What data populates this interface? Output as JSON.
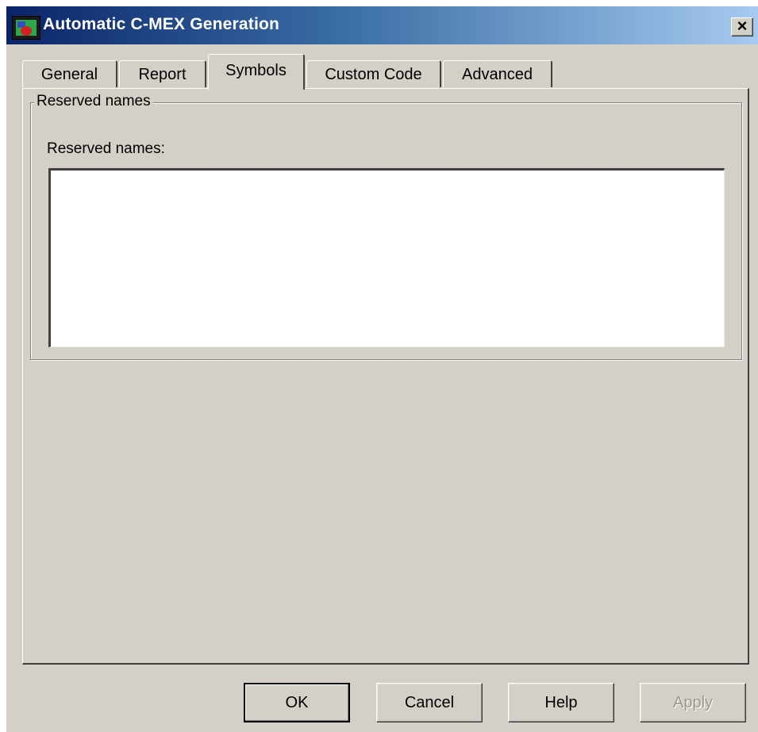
{
  "window": {
    "title": "Automatic C-MEX Generation",
    "close_glyph": "✕",
    "icon": "simulink-app-icon",
    "titlebar_colors": [
      "#0a246a",
      "#a6caf0"
    ]
  },
  "tabs": [
    {
      "label": "General",
      "active": false
    },
    {
      "label": "Report",
      "active": false
    },
    {
      "label": "Symbols",
      "active": true
    },
    {
      "label": "Custom Code",
      "active": false
    },
    {
      "label": "Advanced",
      "active": false
    }
  ],
  "symbols_panel": {
    "group_title": "Reserved names",
    "field_label": "Reserved names:",
    "field_value": ""
  },
  "buttons": {
    "ok": "OK",
    "cancel": "Cancel",
    "help": "Help",
    "apply": "Apply"
  }
}
